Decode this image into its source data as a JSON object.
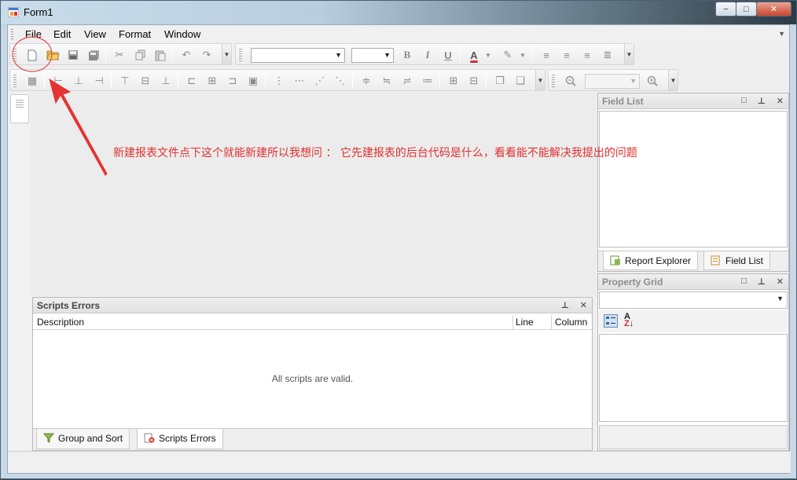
{
  "window": {
    "title": "Form1",
    "buttons": {
      "minimize": "−",
      "maximize": "□",
      "close": "✕"
    }
  },
  "menu": {
    "items": [
      "File",
      "Edit",
      "View",
      "Format",
      "Window"
    ]
  },
  "field_list": {
    "title": "Field List",
    "tabs": [
      "Report Explorer",
      "Field List"
    ]
  },
  "property_grid": {
    "title": "Property Grid"
  },
  "scripts_errors": {
    "title": "Scripts Errors",
    "columns": [
      "Description",
      "Line",
      "Column"
    ],
    "message": "All scripts are valid.",
    "tabs": [
      "Group and Sort",
      "Scripts Errors"
    ]
  },
  "annotation": {
    "text": "新建报表文件点下这个就能新建所以我想问 ： 它先建报表的后台代码是什么，看看能不能解决我提出的问题",
    "color": "#e03030"
  },
  "icons": {
    "toolbar1": [
      "new-icon",
      "open-icon",
      "save-icon",
      "save-all-icon",
      "cut-icon",
      "copy-icon",
      "paste-icon",
      "undo-icon",
      "redo-icon",
      "bold-icon",
      "italic-icon",
      "underline-icon",
      "font-color-icon",
      "highlight-icon",
      "align-left-icon",
      "align-center-icon",
      "align-right-icon",
      "justify-icon"
    ],
    "toolbar3": [
      "zoom-out-icon",
      "zoom-in-icon"
    ]
  }
}
